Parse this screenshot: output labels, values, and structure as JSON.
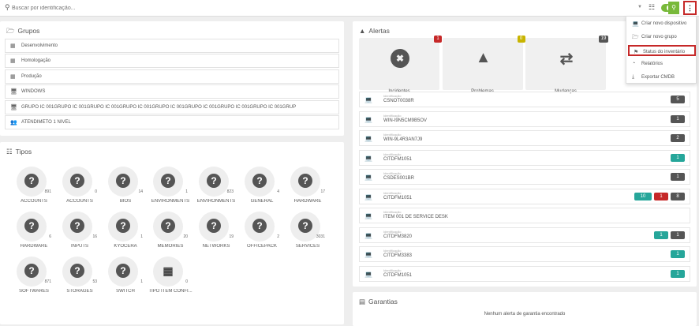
{
  "search": {
    "placeholder": "Buscar por identificação..."
  },
  "grupos": {
    "title": "Grupos",
    "items": [
      {
        "label": "Desenvolvimento"
      },
      {
        "label": "Homologação"
      },
      {
        "label": "Produção"
      },
      {
        "label": "WINDOWS"
      },
      {
        "label": "GRUPO IC 001GRUPO IC 001GRUPO IC 001GRUPO IC 001GRUPO IC 001GRUPO IC 001GRUPO IC 001GRUPO IC 001GRUP"
      },
      {
        "label": "ATENDIMETO 1 NIVEL"
      }
    ]
  },
  "tipos": {
    "title": "Tipos",
    "items": [
      {
        "label": "ACCOUNTS",
        "count": "891"
      },
      {
        "label": "ACCOUNTS",
        "count": "0"
      },
      {
        "label": "BIOS",
        "count": "14"
      },
      {
        "label": "ENVIRONMENTS",
        "count": "1"
      },
      {
        "label": "ENVIRONMENTS",
        "count": "823"
      },
      {
        "label": "GENERAL",
        "count": "4"
      },
      {
        "label": "HARDWARE",
        "count": "17"
      },
      {
        "label": "HARDWARE",
        "count": "6"
      },
      {
        "label": "INPUTS",
        "count": "16"
      },
      {
        "label": "KYOCERA",
        "count": "1"
      },
      {
        "label": "MEMORIES",
        "count": "20"
      },
      {
        "label": "NETWORKS",
        "count": "19"
      },
      {
        "label": "OFFICEPACK",
        "count": "2"
      },
      {
        "label": "SERVICES",
        "count": "3031"
      },
      {
        "label": "SOFTWARES",
        "count": "871"
      },
      {
        "label": "STORAGES",
        "count": "53"
      },
      {
        "label": "SWITCH",
        "count": "1"
      },
      {
        "label": "TIPO ITEM CONFI...",
        "count": "0"
      }
    ]
  },
  "alertas": {
    "title": "Alertas",
    "cards": [
      {
        "label": "Incidentes",
        "badge": "1",
        "color": "#c62828"
      },
      {
        "label": "Problemas",
        "badge": "0",
        "color": "#c8b400"
      },
      {
        "label": "Mudanças",
        "badge": "19",
        "color": "#555555"
      }
    ],
    "sublabel": "Identificação",
    "devices": [
      {
        "name": "CSNOT0038R",
        "badges": [
          {
            "text": "5",
            "color": "#555555"
          }
        ]
      },
      {
        "name": "WIN-I9N5CM9B5OV",
        "badges": [
          {
            "text": "1",
            "color": "#555555"
          }
        ]
      },
      {
        "name": "WIN-9L4R3AN7J9",
        "badges": [
          {
            "text": "2",
            "color": "#555555"
          }
        ]
      },
      {
        "name": "CITDFM1051",
        "badges": [
          {
            "text": "1",
            "color": "#26a69a"
          }
        ]
      },
      {
        "name": "CSDES001BR",
        "badges": [
          {
            "text": "1",
            "color": "#555555"
          }
        ]
      },
      {
        "name": "CITDFM1051",
        "badges": [
          {
            "text": "10",
            "color": "#26a69a"
          },
          {
            "text": "1",
            "color": "#c62828"
          },
          {
            "text": "8",
            "color": "#555555"
          }
        ]
      },
      {
        "name": "ITEM 001 DE SERVICE DESK",
        "badges": []
      },
      {
        "name": "CITDFM3820",
        "badges": [
          {
            "text": "1",
            "color": "#26a69a"
          },
          {
            "text": "1",
            "color": "#555555"
          }
        ]
      },
      {
        "name": "CITDFM3383",
        "badges": [
          {
            "text": "1",
            "color": "#26a69a"
          }
        ]
      },
      {
        "name": "CITDFM1051",
        "badges": [
          {
            "text": "1",
            "color": "#26a69a"
          }
        ]
      }
    ]
  },
  "garantias": {
    "title": "Garantias",
    "message": "Nenhum alerta de garantia encontrado"
  },
  "menu": {
    "items": [
      {
        "label": "Criar novo dispositivo",
        "icon": "laptop-icon"
      },
      {
        "label": "Criar novo grupo",
        "icon": "folder-icon"
      },
      {
        "label": "Status do inventário",
        "icon": "tags-icon"
      },
      {
        "label": "Relatórios",
        "icon": "pie-chart-icon"
      },
      {
        "label": "Exportar CMDB",
        "icon": "download-icon"
      }
    ]
  }
}
